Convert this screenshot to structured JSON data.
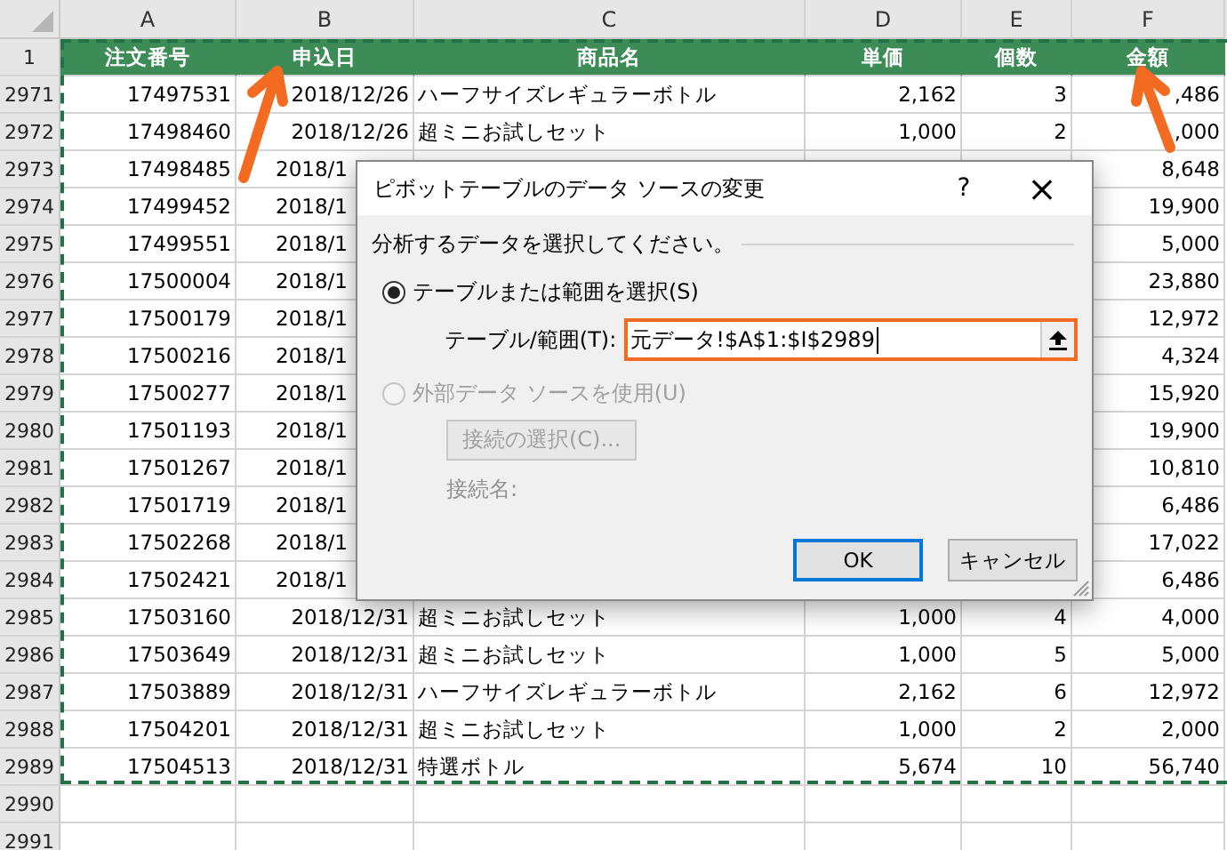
{
  "sheet": {
    "columns": [
      "A",
      "B",
      "C",
      "D",
      "E",
      "F"
    ],
    "header_row": {
      "num": "1",
      "cells": [
        "注文番号",
        "申込日",
        "商品名",
        "単価",
        "個数",
        "金額"
      ]
    },
    "rows": [
      {
        "num": "2971",
        "covered": false,
        "cells": [
          "17497531",
          "2018/12/26",
          "ハーフサイズレギュラーボトル",
          "2,162",
          "3",
          ",486"
        ]
      },
      {
        "num": "2972",
        "covered": false,
        "cells": [
          "17498460",
          "2018/12/26",
          "超ミニお試しセット",
          "1,000",
          "2",
          ",000"
        ]
      },
      {
        "num": "2973",
        "covered": true,
        "cells": [
          "17498485",
          "2018/1",
          null,
          null,
          null,
          "8,648"
        ]
      },
      {
        "num": "2974",
        "covered": true,
        "cells": [
          "17499452",
          "2018/1",
          null,
          null,
          null,
          "19,900"
        ]
      },
      {
        "num": "2975",
        "covered": true,
        "cells": [
          "17499551",
          "2018/1",
          null,
          null,
          null,
          "5,000"
        ]
      },
      {
        "num": "2976",
        "covered": true,
        "cells": [
          "17500004",
          "2018/1",
          null,
          null,
          null,
          "23,880"
        ]
      },
      {
        "num": "2977",
        "covered": true,
        "cells": [
          "17500179",
          "2018/1",
          null,
          null,
          null,
          "12,972"
        ]
      },
      {
        "num": "2978",
        "covered": true,
        "cells": [
          "17500216",
          "2018/1",
          null,
          null,
          null,
          "4,324"
        ]
      },
      {
        "num": "2979",
        "covered": true,
        "cells": [
          "17500277",
          "2018/1",
          null,
          null,
          null,
          "15,920"
        ]
      },
      {
        "num": "2980",
        "covered": true,
        "cells": [
          "17501193",
          "2018/1",
          null,
          null,
          null,
          "19,900"
        ]
      },
      {
        "num": "2981",
        "covered": true,
        "cells": [
          "17501267",
          "2018/1",
          null,
          null,
          null,
          "10,810"
        ]
      },
      {
        "num": "2982",
        "covered": true,
        "cells": [
          "17501719",
          "2018/1",
          null,
          null,
          null,
          "6,486"
        ]
      },
      {
        "num": "2983",
        "covered": true,
        "cells": [
          "17502268",
          "2018/1",
          null,
          null,
          null,
          "17,022"
        ]
      },
      {
        "num": "2984",
        "covered": true,
        "cells": [
          "17502421",
          "2018/1",
          null,
          null,
          null,
          "6,486"
        ]
      },
      {
        "num": "2985",
        "covered": false,
        "cells": [
          "17503160",
          "2018/12/31",
          "超ミニお試しセット",
          "1,000",
          "4",
          "4,000"
        ]
      },
      {
        "num": "2986",
        "covered": false,
        "cells": [
          "17503649",
          "2018/12/31",
          "超ミニお試しセット",
          "1,000",
          "5",
          "5,000"
        ]
      },
      {
        "num": "2987",
        "covered": false,
        "cells": [
          "17503889",
          "2018/12/31",
          "ハーフサイズレギュラーボトル",
          "2,162",
          "6",
          "12,972"
        ]
      },
      {
        "num": "2988",
        "covered": false,
        "cells": [
          "17504201",
          "2018/12/31",
          "超ミニお試しセット",
          "1,000",
          "2",
          "2,000"
        ]
      },
      {
        "num": "2989",
        "covered": false,
        "cells": [
          "17504513",
          "2018/12/31",
          "特選ボトル",
          "5,674",
          "10",
          "56,740"
        ]
      },
      {
        "num": "2990",
        "cells": []
      },
      {
        "num": "2991",
        "cells": []
      }
    ]
  },
  "dialog": {
    "title": "ピボットテーブルのデータ ソースの変更",
    "help": "?",
    "close": "×",
    "section": "分析するデータを選択してください。",
    "options": [
      {
        "kind": "range",
        "label": "テーブルまたは範囲を選択(S)",
        "selected": true,
        "disabled": false,
        "field_label": "テーブル/範囲(T):",
        "value": "元データ!$A$1:$I$2989",
        "highlighted": true
      },
      {
        "kind": "external",
        "label": "外部データ ソースを使用(U)",
        "selected": false,
        "disabled": true,
        "button": "接続の選択(C)...",
        "name_label": "接続名:"
      }
    ],
    "buttons": [
      {
        "label": "OK",
        "default": true
      },
      {
        "label": "キャンセル",
        "default": false
      }
    ]
  }
}
